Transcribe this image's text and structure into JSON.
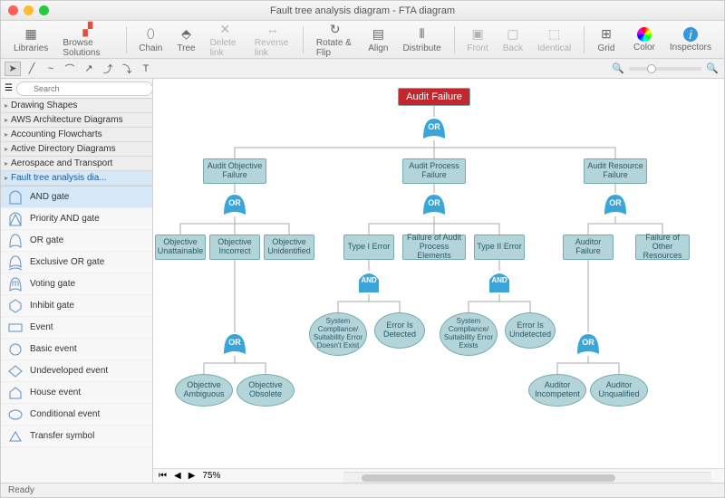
{
  "window": {
    "title": "Fault tree analysis diagram - FTA diagram"
  },
  "toolbar": {
    "libraries": "Libraries",
    "browse": "Browse Solutions",
    "chain": "Chain",
    "tree": "Tree",
    "deleteLink": "Delete link",
    "reverseLink": "Reverse link",
    "rotateFlip": "Rotate & Flip",
    "align": "Align",
    "distribute": "Distribute",
    "front": "Front",
    "back": "Back",
    "identical": "Identical",
    "grid": "Grid",
    "color": "Color",
    "inspectors": "Inspectors"
  },
  "sidebar": {
    "searchPlaceholder": "Search",
    "categories": [
      "Drawing Shapes",
      "AWS Architecture Diagrams",
      "Accounting Flowcharts",
      "Active Directory Diagrams",
      "Aerospace and Transport",
      "Fault tree analysis dia..."
    ],
    "shapes": [
      "AND gate",
      "Priority AND gate",
      "OR gate",
      "Exclusive OR gate",
      "Voting gate",
      "Inhibit gate",
      "Event",
      "Basic event",
      "Undeveloped event",
      "House event",
      "Conditional event",
      "Transfer symbol"
    ]
  },
  "diagram": {
    "top": "Audit Failure",
    "gates": {
      "or": "OR",
      "and": "AND"
    },
    "nodes": {
      "audObjFail": "Audit Objective Failure",
      "audProcFail": "Audit Process Failure",
      "audResFail": "Audit Resource Failure",
      "objUnatt": "Objective Unattainable",
      "objIncorr": "Objective Incorrect",
      "objUnid": "Objective Unidentified",
      "type1": "Type I Error",
      "failElems": "Failure of Audit Process Elements",
      "type2": "Type II Error",
      "audFail": "Auditor Failure",
      "failOther": "Failure of Other Resources",
      "sysNoExist": "System Compliance/ Suitability Error Doesn't Exist",
      "errDet": "Error Is Detected",
      "sysExist": "System Compliance/ Suitability Error Exists",
      "errUndet": "Error Is Undetected",
      "objAmbig": "Objective Ambiguous",
      "objObsol": "Objective Obsolete",
      "audIncomp": "Auditor Incompetent",
      "audUnqual": "Auditor Unqualified"
    }
  },
  "zoom": "75%",
  "status": "Ready"
}
